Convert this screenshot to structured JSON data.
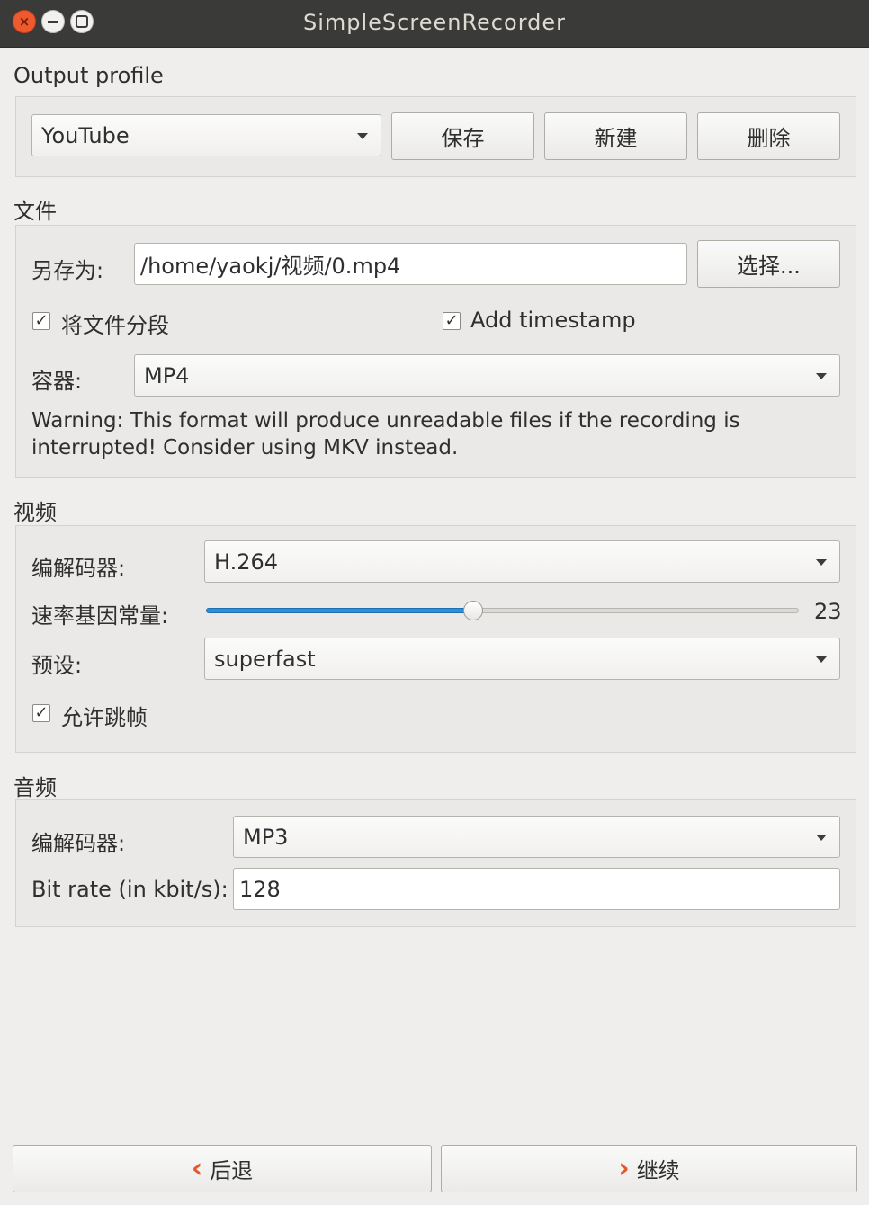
{
  "window": {
    "title": "SimpleScreenRecorder"
  },
  "output_profile": {
    "heading": "Output profile",
    "selected": "YouTube",
    "save_label": "保存",
    "new_label": "新建",
    "delete_label": "删除"
  },
  "file": {
    "heading": "文件",
    "save_as_label": "另存为:",
    "path_value": "/home/yaokj/视频/0.mp4",
    "browse_label": "选择...",
    "split_label": "将文件分段",
    "split_checked": true,
    "timestamp_label": "Add timestamp",
    "timestamp_checked": true,
    "container_label": "容器:",
    "container_value": "MP4",
    "warning": "Warning: This format will produce unreadable files if the recording is interrupted! Consider using MKV instead."
  },
  "video": {
    "heading": "视频",
    "codec_label": "编解码器:",
    "codec_value": "H.264",
    "crf_label": "速率基因常量:",
    "crf_value": "23",
    "crf_fraction": 0.45,
    "preset_label": "预设:",
    "preset_value": "superfast",
    "frameskip_label": "允许跳帧",
    "frameskip_checked": true
  },
  "audio": {
    "heading": "音频",
    "codec_label": "编解码器:",
    "codec_value": "MP3",
    "bitrate_label": "Bit rate (in kbit/s):",
    "bitrate_value": "128"
  },
  "nav": {
    "back_label": "后退",
    "continue_label": "继续"
  },
  "icons": {
    "check": "✓",
    "back": "‹",
    "forward": "›",
    "close": "×"
  }
}
